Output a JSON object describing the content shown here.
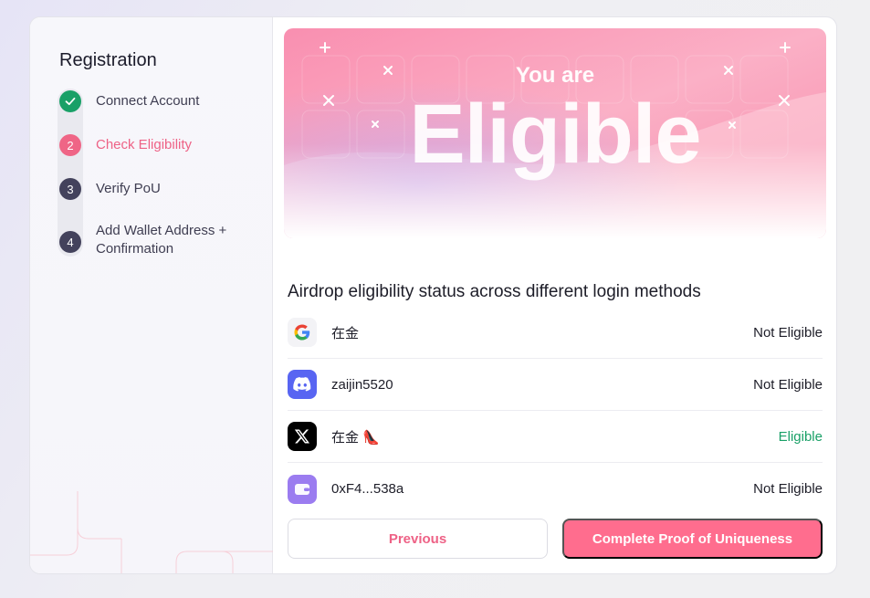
{
  "sidebar": {
    "title": "Registration",
    "steps": [
      {
        "index": "✓",
        "label": "Connect Account",
        "state": "done"
      },
      {
        "index": "2",
        "label": "Check Eligibility",
        "state": "active"
      },
      {
        "index": "3",
        "label": "Verify PoU",
        "state": "pending"
      },
      {
        "index": "4",
        "label": "Add Wallet Address + Confirmation",
        "state": "pending"
      }
    ]
  },
  "banner": {
    "line1": "You are",
    "line2": "Eligible"
  },
  "eligibility": {
    "title": "Airdrop eligibility status across different login methods",
    "rows": [
      {
        "icon": "google-icon",
        "name": "在金",
        "status": "Not Eligible"
      },
      {
        "icon": "discord-icon",
        "name": "zaijin5520",
        "status": "Not Eligible"
      },
      {
        "icon": "x-icon",
        "name": "在金 👠",
        "status": "Eligible"
      },
      {
        "icon": "wallet-icon",
        "name": "0xF4...538a",
        "status": "Not Eligible"
      }
    ]
  },
  "actions": {
    "previous": "Previous",
    "complete": "Complete Proof of Uniqueness"
  },
  "colors": {
    "accent": "#ff6d8e",
    "success": "#19a067",
    "pending_dot": "#43425c"
  }
}
